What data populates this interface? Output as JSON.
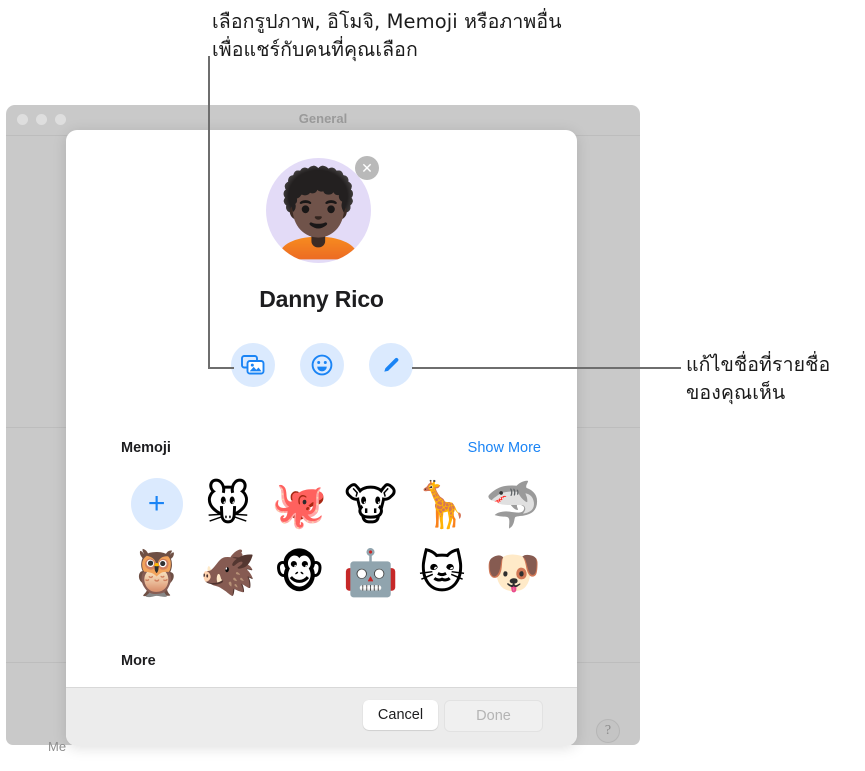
{
  "annotations": {
    "top": "เลือกรูปภาพ, อิโมจิ, Memoji หรือภาพอื่น\nเพื่อแชร์กับคนที่คุณเลือก",
    "right": "แก้ไขชื่อที่รายชื่อ\nของคุณเห็น"
  },
  "background_window": {
    "title": "General",
    "partial_label": "Me",
    "help_label": "?",
    "traffic_lights": [
      "close",
      "minimize",
      "zoom"
    ]
  },
  "dialog": {
    "avatar": {
      "icon": "memoji-avatar",
      "glyph": "🧑🏿‍🦱",
      "background_color": "#e3dbf7",
      "remove_icon": "close-icon",
      "remove_glyph": "✕"
    },
    "profile_name": "Danny Rico",
    "actions": [
      {
        "name": "photos",
        "icon": "photos-icon",
        "label": "Photos"
      },
      {
        "name": "emoji",
        "icon": "emoji-icon",
        "label": "Emoji"
      },
      {
        "name": "monogram",
        "icon": "pencil-icon",
        "label": "Edit Name"
      }
    ],
    "memoji_section": {
      "title": "Memoji",
      "action_label": "Show More",
      "items": [
        {
          "name": "new-memoji",
          "icon": "plus-icon",
          "glyph": "+",
          "is_add_button": true
        },
        {
          "name": "mouse",
          "icon": "mouse-memoji",
          "glyph": "🐭"
        },
        {
          "name": "octopus",
          "icon": "octopus-memoji",
          "glyph": "🐙"
        },
        {
          "name": "cow",
          "icon": "cow-memoji",
          "glyph": "🐮"
        },
        {
          "name": "giraffe",
          "icon": "giraffe-memoji",
          "glyph": "🦒"
        },
        {
          "name": "shark",
          "icon": "shark-memoji",
          "glyph": "🦈"
        },
        {
          "name": "owl",
          "icon": "owl-memoji",
          "glyph": "🦉"
        },
        {
          "name": "boar",
          "icon": "boar-memoji",
          "glyph": "🐗"
        },
        {
          "name": "monkey",
          "icon": "monkey-memoji",
          "glyph": "🐵"
        },
        {
          "name": "robot",
          "icon": "robot-memoji",
          "glyph": "🤖"
        },
        {
          "name": "cat",
          "icon": "cat-memoji",
          "glyph": "🐱"
        },
        {
          "name": "dog",
          "icon": "dog-memoji",
          "glyph": "🐶"
        }
      ]
    },
    "more_section": {
      "title": "More"
    },
    "footer": {
      "cancel_label": "Cancel",
      "done_label": "Done",
      "done_enabled": false
    }
  },
  "colors": {
    "accent_blue": "#1a84f5",
    "action_button_bg": "#dbeafe",
    "avatar_bg": "#e3dbf7",
    "window_chrome": "#c9c9c9",
    "footer_bg": "#ececec",
    "leader_line": "#6e6e6e"
  }
}
